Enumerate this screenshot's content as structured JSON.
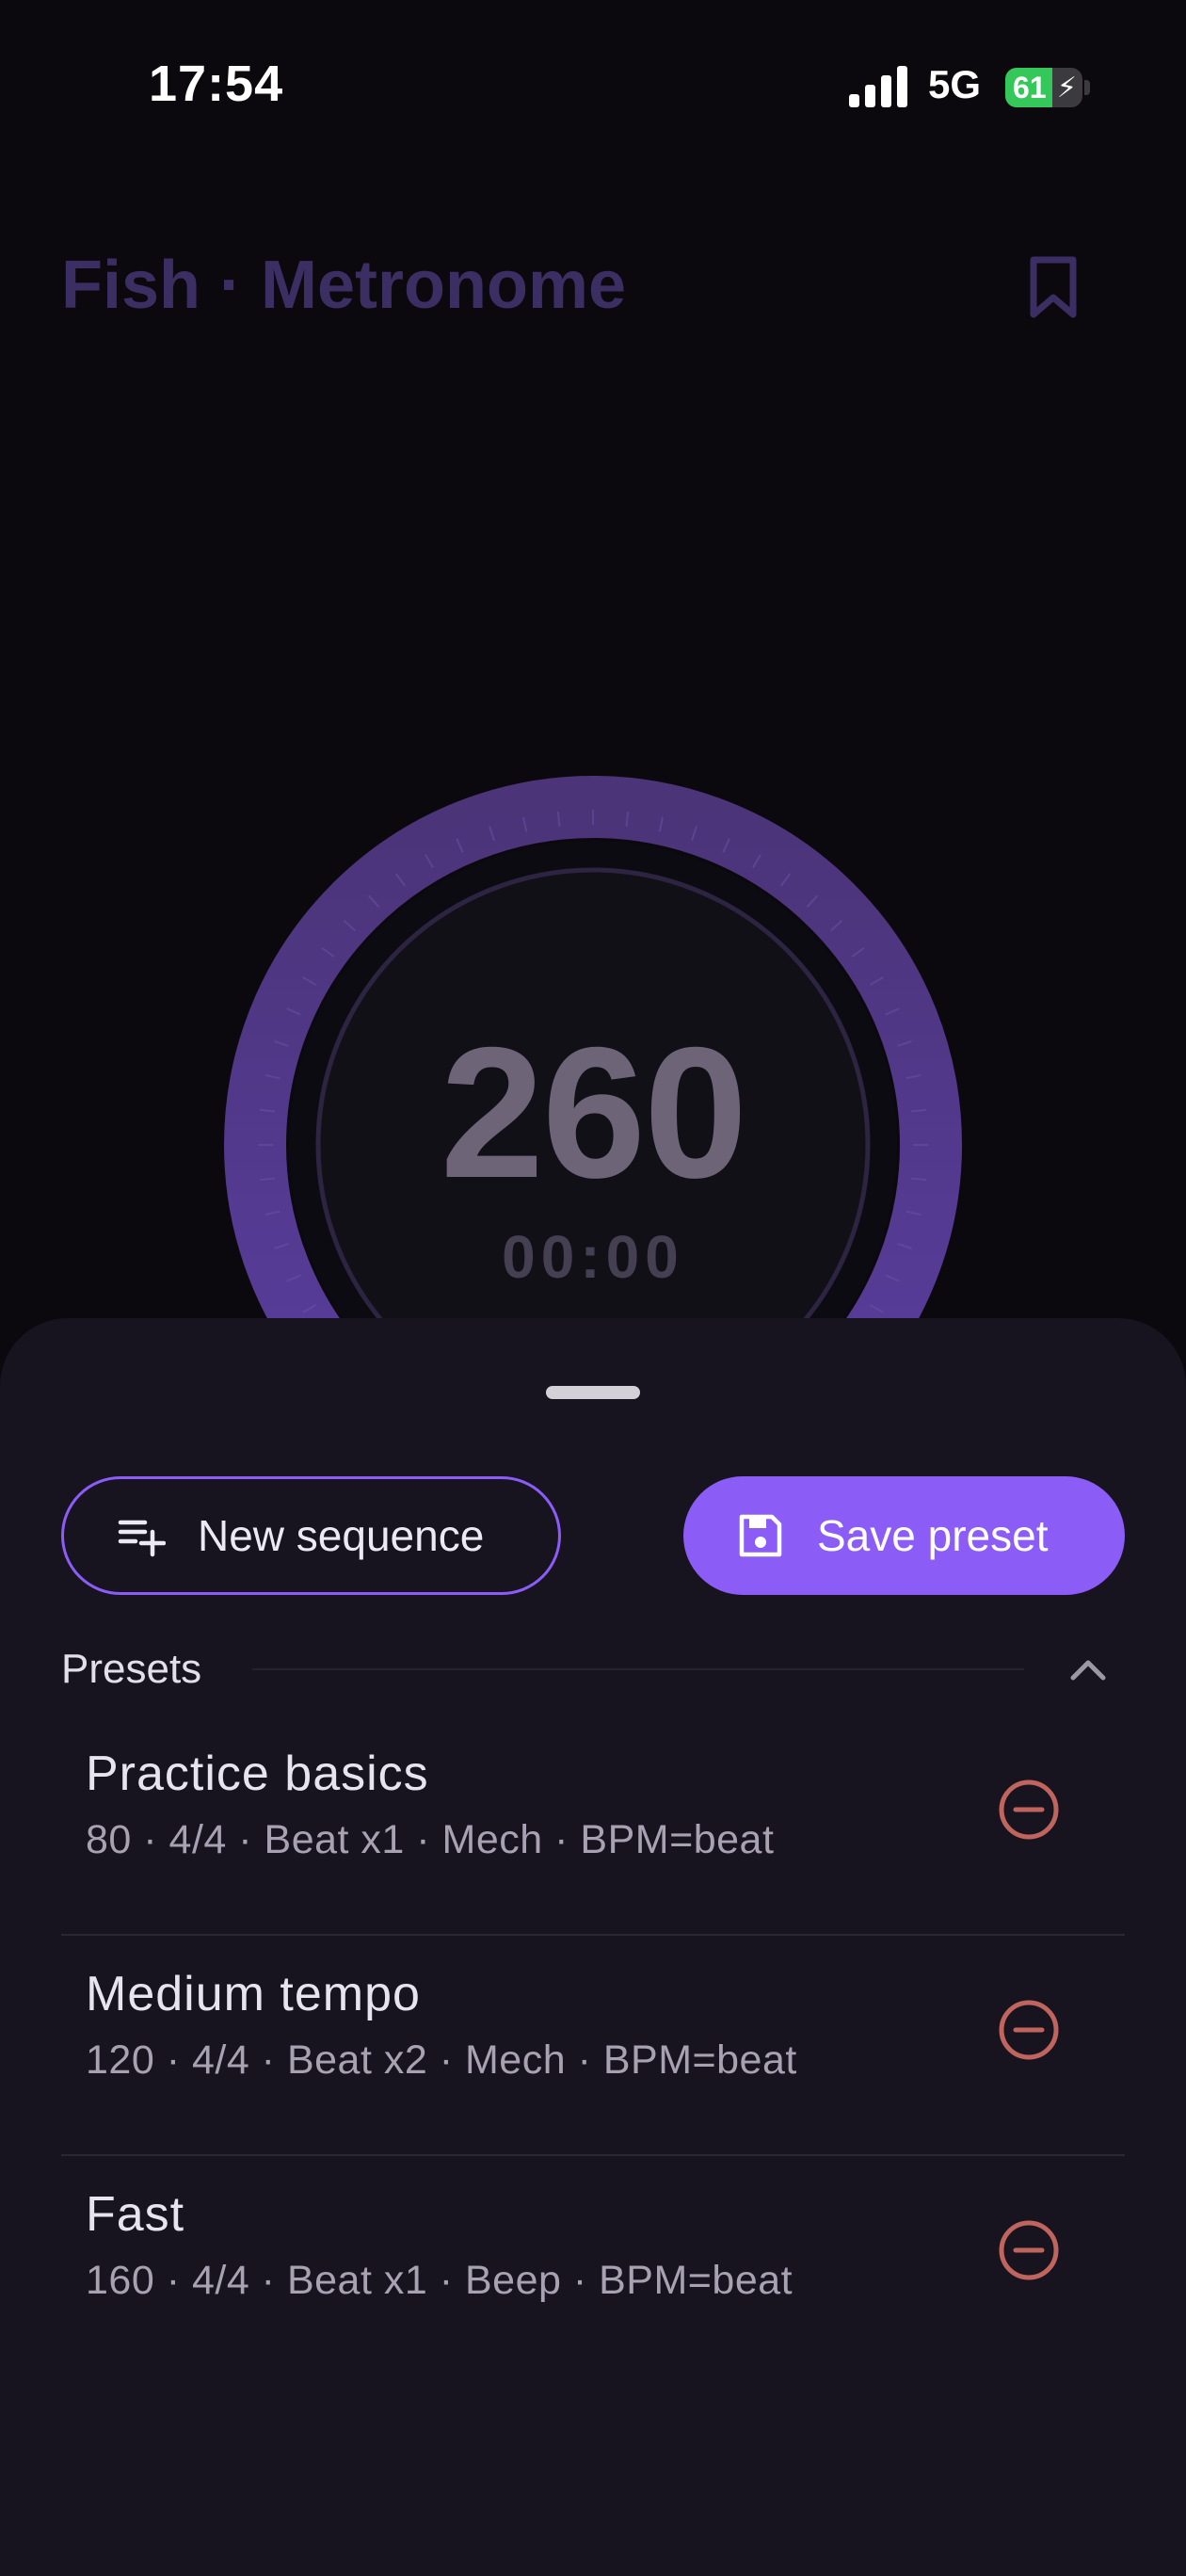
{
  "status_bar": {
    "time": "17:54",
    "network": "5G",
    "battery_percent": "61",
    "battery_level": 0.61,
    "signal_bars": 4
  },
  "header": {
    "title": "Fish · Metronome",
    "bookmark_icon": "bookmark-icon"
  },
  "metronome": {
    "bpm": "260",
    "elapsed": "00:00",
    "dial_color": "#5a3d9a"
  },
  "sheet": {
    "new_sequence_label": "New sequence",
    "new_sequence_icon": "playlist-add-icon",
    "save_preset_label": "Save preset",
    "save_preset_icon": "save-icon",
    "presets_heading": "Presets",
    "collapse_icon": "chevron-up-icon",
    "remove_icon": "remove-circle-icon",
    "presets": [
      {
        "name": "Practice basics",
        "details": "80 · 4/4 · Beat x1 · Mech · BPM=beat"
      },
      {
        "name": "Medium tempo",
        "details": "120 · 4/4 · Beat x2 · Mech · BPM=beat"
      },
      {
        "name": "Fast",
        "details": "160 · 4/4 · Beat x1 · Beep · BPM=beat"
      }
    ]
  },
  "colors": {
    "accent": "#8b5cf6",
    "remove": "#c0645e",
    "sheet_bg": "#17141f"
  }
}
